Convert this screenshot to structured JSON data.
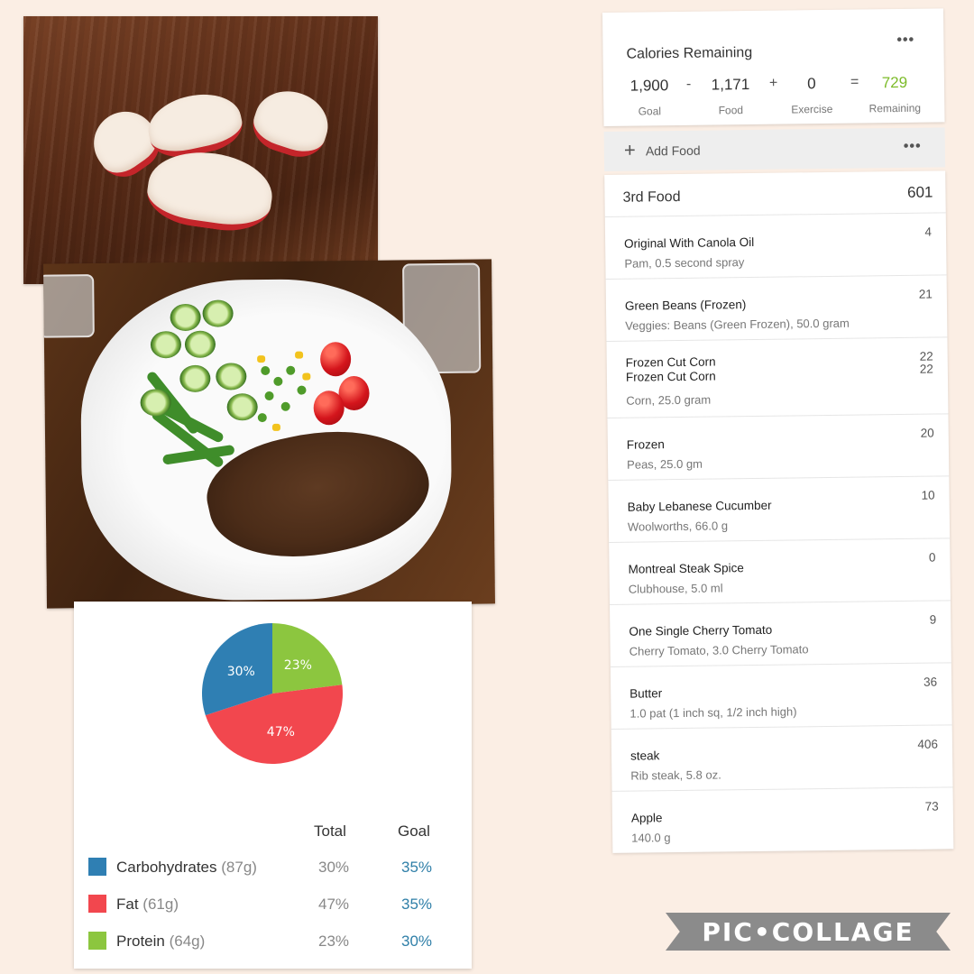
{
  "diary": {
    "calories": {
      "title": "Calories Remaining",
      "more": "•••",
      "goal_value": "1,900",
      "goal_label": "Goal",
      "minus": "-",
      "food_value": "1,171",
      "food_label": "Food",
      "plus": "+",
      "exercise_value": "0",
      "exercise_label": "Exercise",
      "equals": "=",
      "remaining_value": "729",
      "remaining_label": "Remaining",
      "remaining_color": "#7cbb29"
    },
    "add_food": {
      "icon": "plus-icon",
      "plus": "+",
      "label": "Add Food",
      "more": "•••"
    },
    "meal": {
      "name": "3rd Food",
      "total": "601",
      "items": [
        {
          "name": "Original With Canola Oil",
          "desc": "Pam, 0.5 second spray",
          "cal": "4"
        },
        {
          "name": "Green Beans (Frozen)",
          "desc": "Veggies:  Beans (Green Frozen), 50.0 gram",
          "cal": "21"
        },
        {
          "name": "Frozen Cut Corn",
          "name2": "Frozen Cut Corn",
          "desc": "Corn, 25.0 gram",
          "cal": "22",
          "cal2": "22"
        },
        {
          "name": "Frozen",
          "desc": "Peas, 25.0 gm",
          "cal": "20"
        },
        {
          "name": "Baby Lebanese Cucumber",
          "desc": "Woolworths, 66.0 g",
          "cal": "10"
        },
        {
          "name": "Montreal Steak Spice",
          "desc": "Clubhouse, 5.0 ml",
          "cal": "0"
        },
        {
          "name": "One Single Cherry Tomato",
          "desc": "Cherry Tomato, 3.0 Cherry Tomato",
          "cal": "9"
        },
        {
          "name": "Butter",
          "desc": "1.0 pat (1 inch sq, 1/2 inch high)",
          "cal": "36"
        },
        {
          "name": "steak",
          "desc": "Rib steak, 5.8 oz.",
          "cal": "406"
        },
        {
          "name": "Apple",
          "desc": "140.0 g",
          "cal": "73"
        }
      ]
    }
  },
  "macros": {
    "header_total": "Total",
    "header_goal": "Goal",
    "rows": [
      {
        "name": "Carbohydrates",
        "grams": "(87g)",
        "total": "30%",
        "goal": "35%",
        "color": "#2f7fb3"
      },
      {
        "name": "Fat",
        "grams": "(61g)",
        "total": "47%",
        "goal": "35%",
        "color": "#f2474e"
      },
      {
        "name": "Protein",
        "grams": "(64g)",
        "total": "23%",
        "goal": "30%",
        "color": "#8cc63f"
      }
    ]
  },
  "chart_data": {
    "type": "pie",
    "title": "",
    "categories": [
      "Carbohydrates",
      "Fat",
      "Protein"
    ],
    "values": [
      30,
      47,
      23
    ],
    "labels": [
      "30%",
      "47%",
      "23%"
    ],
    "colors": [
      "#2f7fb3",
      "#f2474e",
      "#8cc63f"
    ]
  },
  "watermark": {
    "text": "PIC•COLLAGE"
  }
}
